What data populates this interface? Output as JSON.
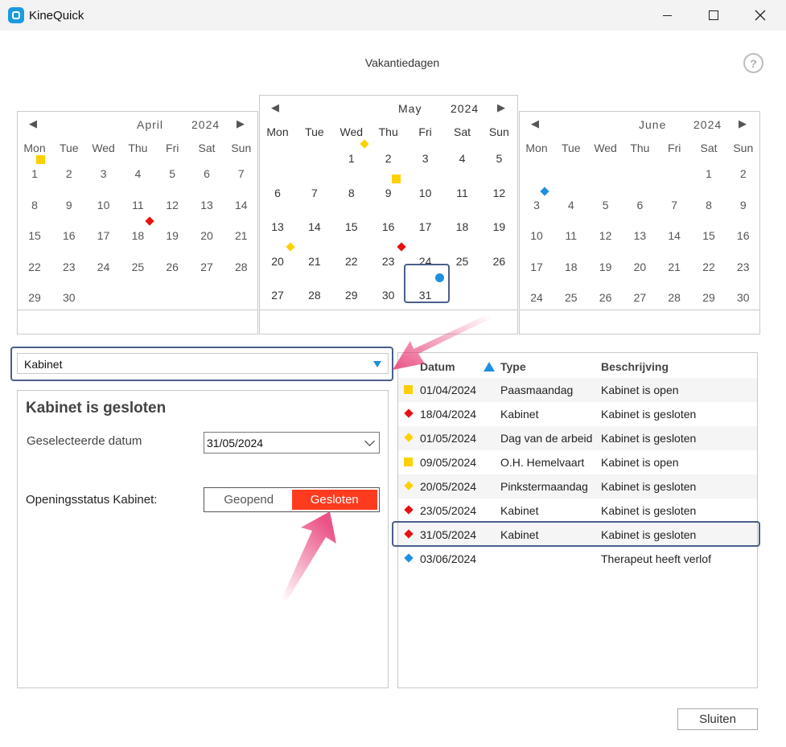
{
  "window": {
    "title": "KineQuick"
  },
  "page": {
    "title": "Vakantiedagen",
    "help": "?"
  },
  "colors": {
    "yellow": "#ffd000",
    "red": "#e81010",
    "blue": "#1e90e0",
    "status_closed": "#ff3b1f"
  },
  "calendars": [
    {
      "month": "April",
      "year": "2024",
      "prev": "◀",
      "next": "▶",
      "dow": [
        "Mon",
        "Tue",
        "Wed",
        "Thu",
        "Fri",
        "Sat",
        "Sun"
      ],
      "first_col": 0,
      "days": 30,
      "markers": {
        "1": "yellow-square",
        "18": "red-diamond"
      }
    },
    {
      "month": "May",
      "year": "2024",
      "prev": "◀",
      "next": "▶",
      "dow": [
        "Mon",
        "Tue",
        "Wed",
        "Thu",
        "Fri",
        "Sat",
        "Sun"
      ],
      "first_col": 2,
      "days": 31,
      "markers": {
        "1": "yellow-diamond",
        "9": "yellow-square",
        "20": "yellow-diamond",
        "23": "red-diamond",
        "31": "blue-circle"
      },
      "selected": 31
    },
    {
      "month": "June",
      "year": "2024",
      "prev": "◀",
      "next": "▶",
      "dow": [
        "Mon",
        "Tue",
        "Wed",
        "Thu",
        "Fri",
        "Sat",
        "Sun"
      ],
      "first_col": 5,
      "days": 30,
      "markers": {
        "3": "blue-diamond"
      }
    }
  ],
  "filter": {
    "value": "Kabinet"
  },
  "detail": {
    "title": "Kabinet is gesloten",
    "date_label": "Geselecteerde datum",
    "date_value": "31/05/2024",
    "status_label": "Openingsstatus Kabinet:",
    "status_open": "Geopend",
    "status_closed": "Gesloten",
    "status_selected": "Gesloten"
  },
  "list": {
    "headers": {
      "date": "Datum",
      "type": "Type",
      "description": "Beschrijving"
    },
    "rows": [
      {
        "marker": "yellow-square",
        "date": "01/04/2024",
        "type": "Paasmaandag",
        "description": "Kabinet is open"
      },
      {
        "marker": "red-diamond",
        "date": "18/04/2024",
        "type": "Kabinet",
        "description": "Kabinet is gesloten"
      },
      {
        "marker": "yellow-diamond",
        "date": "01/05/2024",
        "type": "Dag van de arbeid",
        "description": "Kabinet is gesloten"
      },
      {
        "marker": "yellow-square",
        "date": "09/05/2024",
        "type": "O.H. Hemelvaart",
        "description": "Kabinet is open"
      },
      {
        "marker": "yellow-diamond",
        "date": "20/05/2024",
        "type": "Pinkstermaandag",
        "description": "Kabinet is gesloten"
      },
      {
        "marker": "red-diamond",
        "date": "23/05/2024",
        "type": "Kabinet",
        "description": "Kabinet is gesloten"
      },
      {
        "marker": "red-diamond",
        "date": "31/05/2024",
        "type": "Kabinet",
        "description": "Kabinet is gesloten"
      },
      {
        "marker": "blue-diamond",
        "date": "03/06/2024",
        "type": "",
        "description": "Therapeut heeft verlof"
      }
    ],
    "selected_index": 6
  },
  "footer": {
    "close_label": "Sluiten"
  }
}
